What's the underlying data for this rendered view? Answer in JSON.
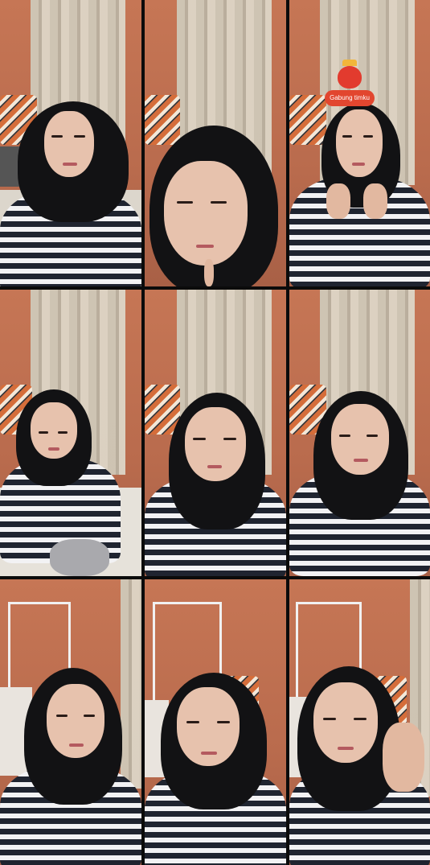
{
  "grid": {
    "rows": 3,
    "cols": 3,
    "cells": [
      {
        "id": "r1c1",
        "scene": "wall-curtain"
      },
      {
        "id": "r1c2",
        "scene": "close-up"
      },
      {
        "id": "r1c3",
        "scene": "wall-curtain-with-badge"
      },
      {
        "id": "r2c1",
        "scene": "wall-curtain"
      },
      {
        "id": "r2c2",
        "scene": "wall-curtain"
      },
      {
        "id": "r2c3",
        "scene": "wall-curtain"
      },
      {
        "id": "r3c1",
        "scene": "clothes-rack"
      },
      {
        "id": "r3c2",
        "scene": "clothes-rack"
      },
      {
        "id": "r3c3",
        "scene": "clothes-rack"
      }
    ]
  },
  "badge": {
    "label": "Gabung timku",
    "icon": "heart-mascot-icon",
    "color": "#e2462f"
  },
  "colors": {
    "wall": "#c67655",
    "divider": "#0b0b0b",
    "hijab": "#121214",
    "stripe_dark": "#1f2430",
    "stripe_light": "#f2f2f4"
  }
}
